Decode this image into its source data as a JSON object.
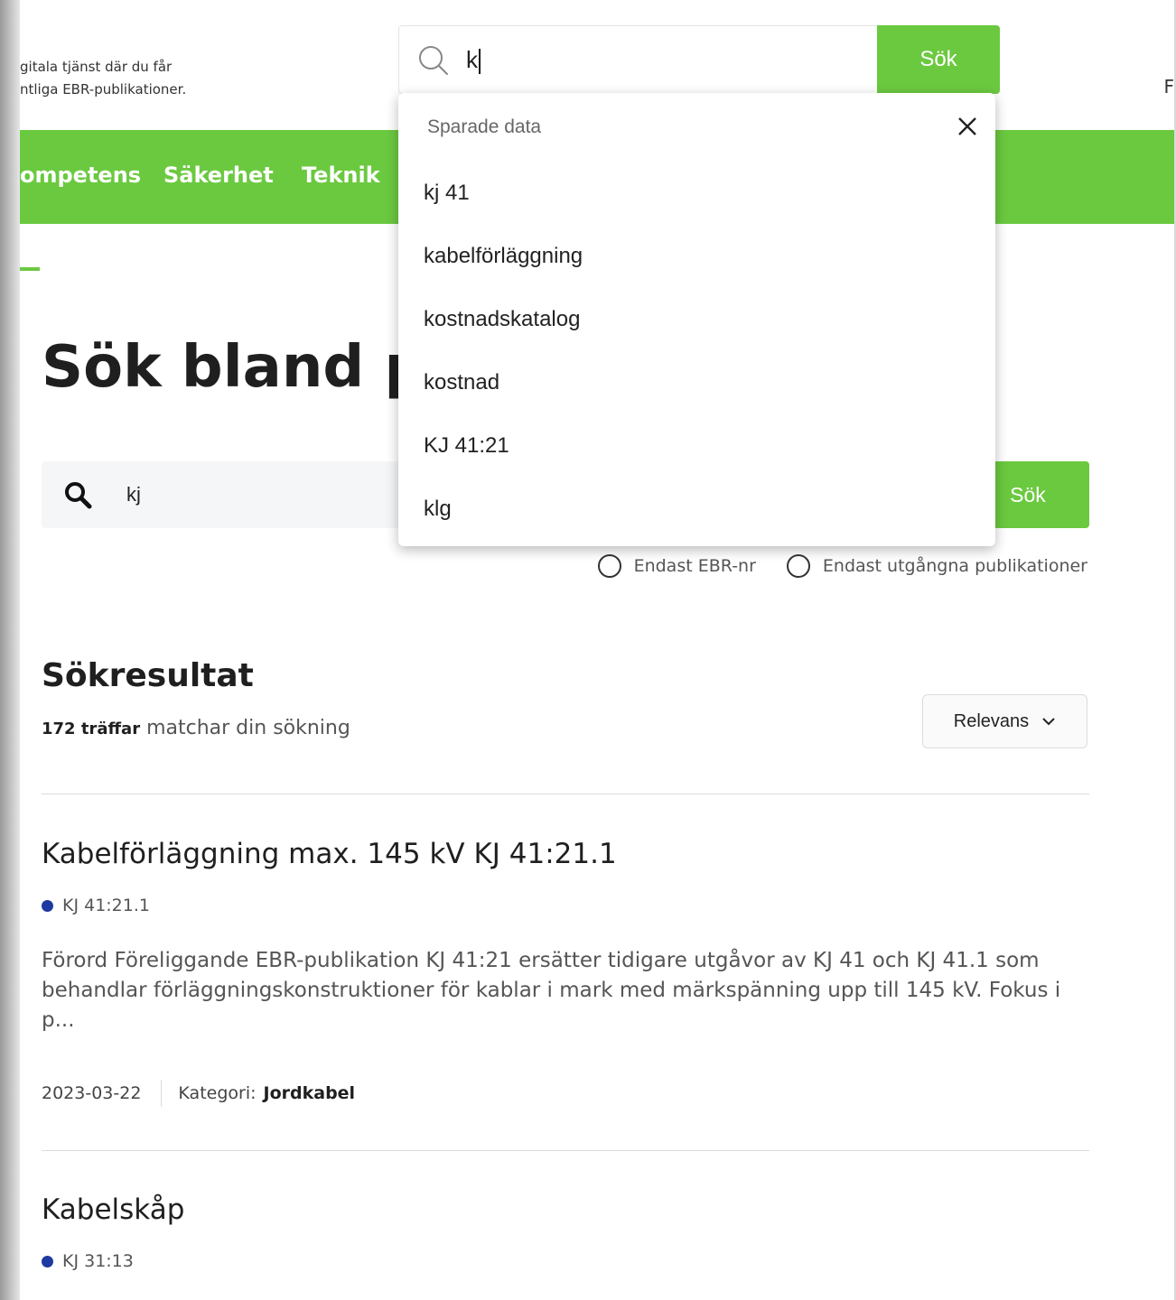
{
  "header": {
    "tagline_line1": "gitala tjänst där du får",
    "tagline_line2": "ntliga EBR-publikationer.",
    "corner_text": "F"
  },
  "top_search": {
    "value": "k",
    "button_label": "Sök",
    "dropdown": {
      "header": "Sparade data",
      "items": [
        "kj 41",
        "kabelförläggning",
        "kostnadskatalog",
        "kostnad",
        "KJ 41:21",
        "klg"
      ]
    }
  },
  "nav": {
    "items": [
      "ompetens",
      "Säkerhet",
      "Teknik"
    ]
  },
  "page": {
    "title": "Sök bland publikationer"
  },
  "main_search": {
    "value": "kj",
    "button_label": "Sök",
    "options": [
      "Endast EBR-nr",
      "Endast utgångna publikationer"
    ]
  },
  "results": {
    "heading": "Sökresultat",
    "count": "172 träffar",
    "count_suffix": "matchar din sökning",
    "sort_label": "Relevans",
    "items": [
      {
        "title": "Kabelförläggning max. 145 kV KJ 41:21.1",
        "code": "KJ 41:21.1",
        "snippet": "Förord Föreliggande EBR-publikation KJ 41:21 ersätter tidigare utgåvor av KJ 41 och KJ 41.1 som behandlar förläggningskonstruktioner för kablar i mark med märkspänning upp till 145 kV. Fokus i p...",
        "date": "2023-03-22",
        "category_label": "Kategori:",
        "category": "Jordkabel"
      },
      {
        "title": "Kabelskåp",
        "code": "KJ 31:13"
      }
    ]
  },
  "colors": {
    "brand_green": "#6bc940",
    "code_dot": "#1e3aa0"
  },
  "icons": [
    "search-icon",
    "close-icon",
    "chevron-down-icon",
    "radio-icon"
  ]
}
